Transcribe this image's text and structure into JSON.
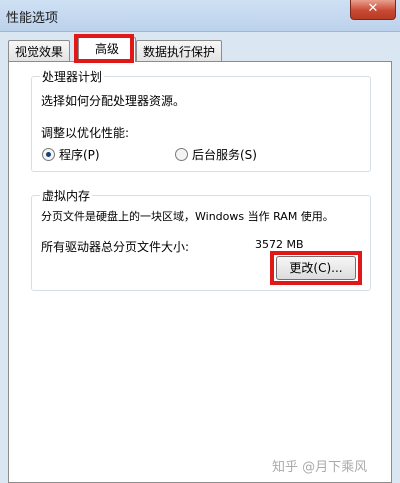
{
  "window": {
    "title": "性能选项",
    "close_label": "✕"
  },
  "tabs": [
    {
      "label": "视觉效果"
    },
    {
      "label": "高级"
    },
    {
      "label": "数据执行保护"
    }
  ],
  "processor": {
    "legend": "处理器计划",
    "description": "选择如何分配处理器资源。",
    "adjust_label": "调整以优化性能:",
    "option_programs": "程序(P)",
    "option_services": "后台服务(S)",
    "selected": "程序(P)"
  },
  "virtual_memory": {
    "legend": "虚拟内存",
    "description": "分页文件是硬盘上的一块区域，Windows 当作 RAM 使用。",
    "total_label": "所有驱动器总分页文件大小:",
    "total_value": "3572 MB",
    "change_button": "更改(C)..."
  },
  "watermark": "知乎 @月下乘风",
  "colors": {
    "highlight": "#e01818",
    "window": "#dbe6f3"
  }
}
